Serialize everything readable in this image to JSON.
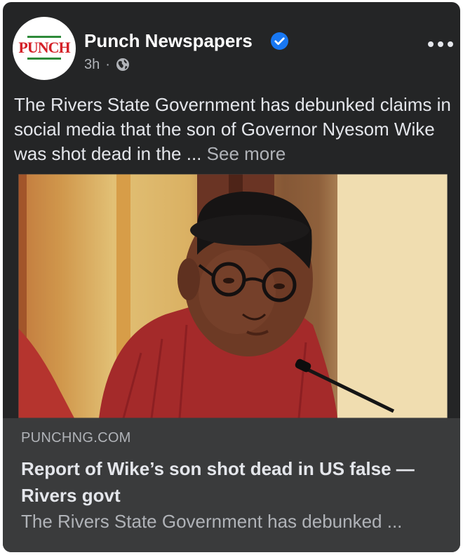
{
  "post": {
    "page_name": "Punch Newspapers",
    "logo_text": "PUNCH",
    "verified_icon": "verified-badge-icon",
    "time": "3h",
    "separator": "·",
    "privacy_icon": "globe-icon",
    "more_icon": "more-options-icon",
    "text": "The Rivers State Government has debunked claims in social media that the son of Governor Nyesom Wike was shot dead in the",
    "truncation": " ...",
    "see_more": "See more"
  },
  "link_preview": {
    "domain": "PUNCHNG.COM",
    "headline": "Report of Wike’s son shot dead in US false — Rivers govt",
    "description": "The Rivers State Government has debunked ..."
  },
  "colors": {
    "card_bg": "#242526",
    "preview_bg": "#3a3b3c",
    "primary_text": "#e4e6eb",
    "secondary_text": "#b0b3b8",
    "verified_blue": "#1877f2",
    "logo_red": "#d42027",
    "logo_green": "#2e8b3a"
  }
}
